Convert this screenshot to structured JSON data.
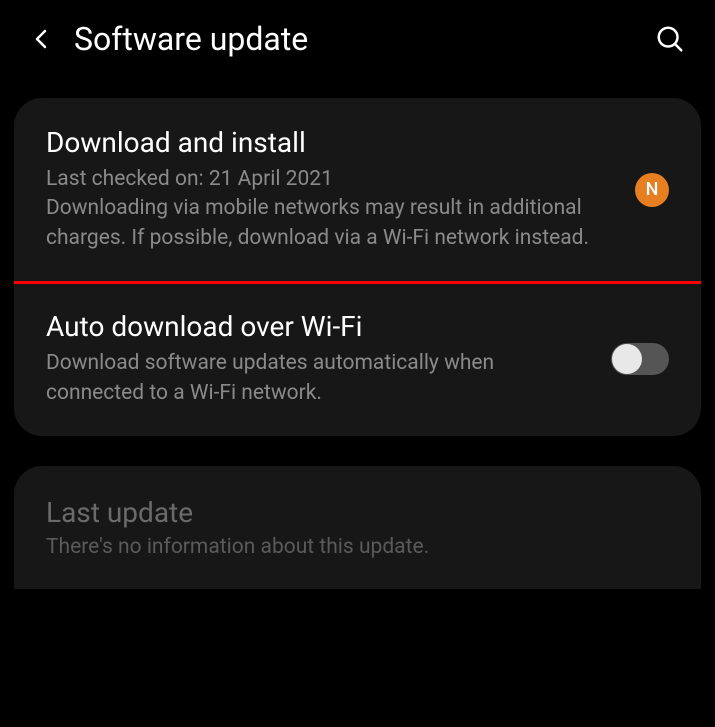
{
  "header": {
    "title": "Software update"
  },
  "card1": {
    "download": {
      "title": "Download and install",
      "desc": "Last checked on: 21 April 2021\nDownloading via mobile networks may result in additional charges. If possible, download via a Wi-Fi network instead.",
      "badge": "N"
    },
    "auto": {
      "title": "Auto download over Wi-Fi",
      "desc": "Download software updates automatically when connected to a Wi-Fi network.",
      "toggleOn": false
    }
  },
  "card2": {
    "title": "Last update",
    "desc": "There's no information about this update."
  }
}
